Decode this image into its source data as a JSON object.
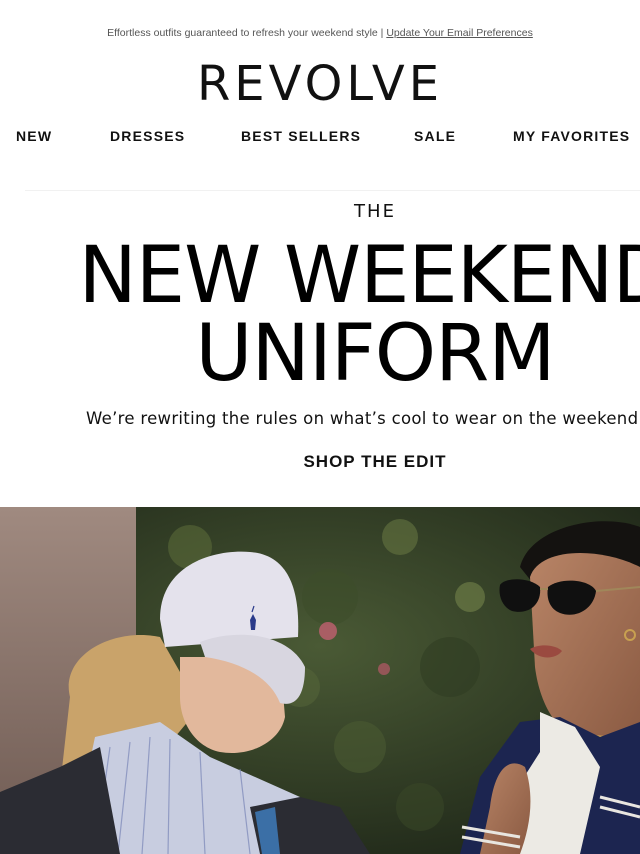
{
  "preheader": {
    "text": "Effortless outfits guaranteed to refresh your weekend style | ",
    "link": "Update Your Email Preferences"
  },
  "brand": {
    "logo": "REVOLVE"
  },
  "nav": {
    "items": [
      {
        "label": "NEW"
      },
      {
        "label": "DRESSES"
      },
      {
        "label": "BEST SELLERS"
      },
      {
        "label": "SALE"
      },
      {
        "label": "MY FAVORITES"
      }
    ]
  },
  "hero_text": {
    "eyebrow": "THE",
    "line1": "NEW WEEKEND",
    "line2": "UNIFORM",
    "subtitle": "We’re rewriting the rules on what’s cool to wear on the weekend.",
    "cta": "SHOP THE EDIT"
  },
  "hero_image": {
    "cap_logo_icon": "polo-player-icon"
  },
  "colors": {
    "background": "#ffffff",
    "text": "#111111",
    "cap": "#e4e2ec",
    "foliage": "#2e3a24"
  }
}
